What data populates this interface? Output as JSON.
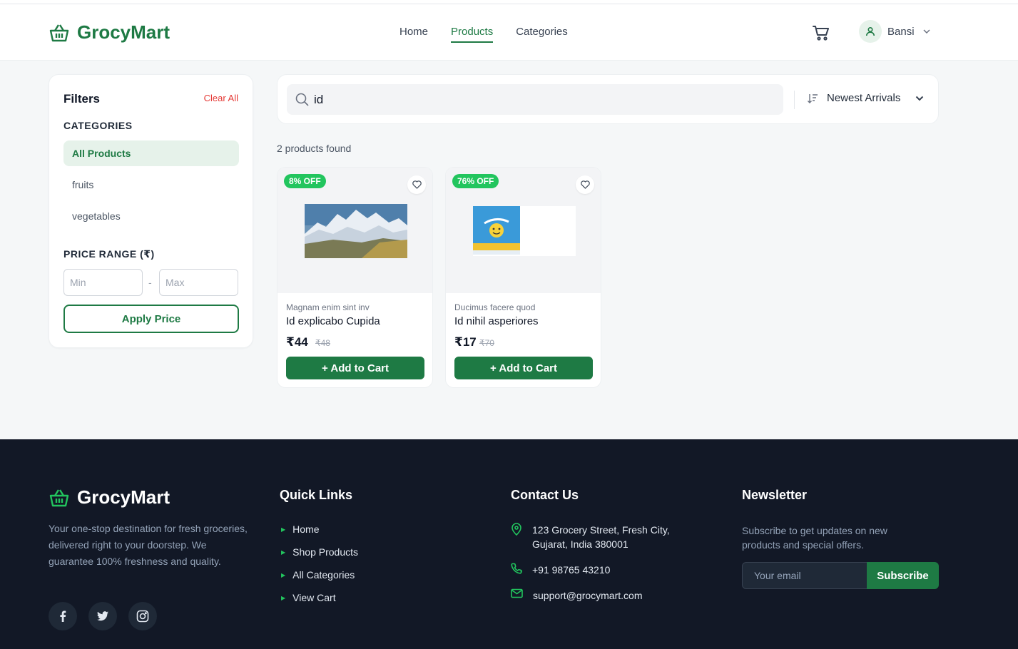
{
  "brand": {
    "name": "GrocyMart",
    "accent": "#1e7a44"
  },
  "nav": {
    "home": "Home",
    "products": "Products",
    "categories": "Categories"
  },
  "user": {
    "name": "Bansi"
  },
  "filters": {
    "title": "Filters",
    "clear_all": "Clear All",
    "categories_title": "CATEGORIES",
    "categories": [
      "All Products",
      "fruits",
      "vegetables"
    ],
    "price_range_title": "PRICE RANGE (₹)",
    "min_placeholder": "Min",
    "max_placeholder": "Max",
    "dash": "-",
    "apply_label": "Apply Price"
  },
  "search": {
    "value": "id"
  },
  "sort": {
    "selected": "Newest Arrivals"
  },
  "results": {
    "count_text": "2 products found"
  },
  "products": [
    {
      "badge": "8% OFF",
      "category": "Magnam enim sint inv",
      "name": "Id explicabo Cupida",
      "price": "₹44",
      "old_price": "₹48",
      "add_label": "+ Add to Cart"
    },
    {
      "badge": "76% OFF",
      "category": "Ducimus facere quod",
      "name": "Id nihil asperiores",
      "price": "₹17",
      "old_price": "₹70",
      "add_label": "+ Add to Cart"
    }
  ],
  "footer": {
    "brand": "GrocyMart",
    "description": "Your one-stop destination for fresh groceries, delivered right to your doorstep. We guarantee 100% freshness and quality.",
    "quick_links_title": "Quick Links",
    "quick_links": [
      "Home",
      "Shop Products",
      "All Categories",
      "View Cart"
    ],
    "contact_title": "Contact Us",
    "address_line1": "123 Grocery Street, Fresh City,",
    "address_line2": "Gujarat, India 380001",
    "phone": "+91 98765 43210",
    "email": "support@grocymart.com",
    "newsletter_title": "Newsletter",
    "newsletter_text": "Subscribe to get updates on new products and special offers.",
    "email_placeholder": "Your email",
    "subscribe_label": "Subscribe"
  }
}
